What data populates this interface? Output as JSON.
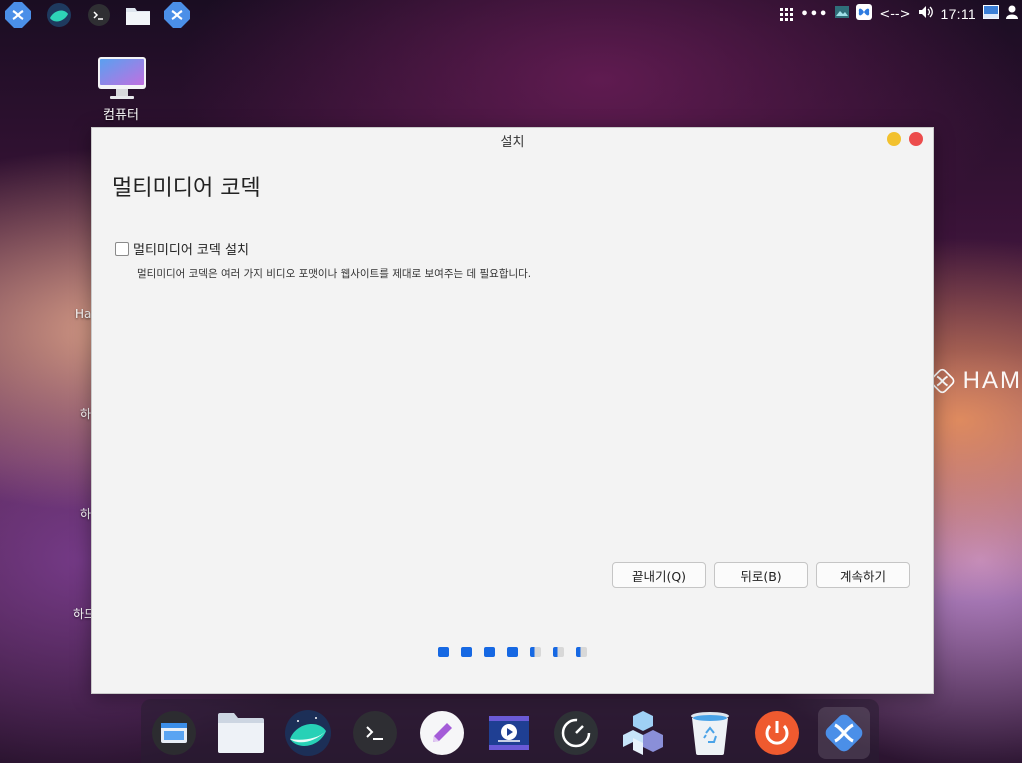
{
  "top_panel": {
    "apps": [
      {
        "name": "hamonikr-logo-icon"
      },
      {
        "name": "whale-browser-icon"
      },
      {
        "name": "terminal-icon"
      },
      {
        "name": "folder-icon"
      },
      {
        "name": "hamonikr-app-icon"
      }
    ],
    "tray": {
      "network_glyph": "<-->",
      "clock": "17:11"
    }
  },
  "desktop": {
    "computer_label": "컴퓨터",
    "peek_labels": [
      "Ha",
      "하",
      "하",
      "하드"
    ],
    "brand_text": "HAM"
  },
  "window": {
    "title": "설치",
    "heading": "멀티미디어 코덱",
    "option_label": "멀티미디어 코덱 설치",
    "option_checked": false,
    "option_description": "멀티미디어 코덱은 여러 가지 비디오 포맷이나 웹사이트를 제대로 보여주는 데 필요합니다.",
    "buttons": {
      "quit": "끝내기(Q)",
      "back": "뒤로(B)",
      "continue": "계속하기"
    },
    "progress": {
      "completed_steps": 4,
      "total_steps": 7
    }
  },
  "dock": {
    "items": [
      "window-manager-icon",
      "file-manager-icon",
      "whale-browser-icon",
      "terminal-icon",
      "text-editor-icon",
      "video-editor-icon",
      "system-monitor-icon",
      "software-center-icon",
      "trash-icon",
      "power-icon",
      "hamonikr-installer-icon"
    ]
  },
  "colors": {
    "accent": "#1668e3",
    "window_bg": "#f3f3f3",
    "minimize": "#f2c12e",
    "close": "#ec4c4c"
  }
}
